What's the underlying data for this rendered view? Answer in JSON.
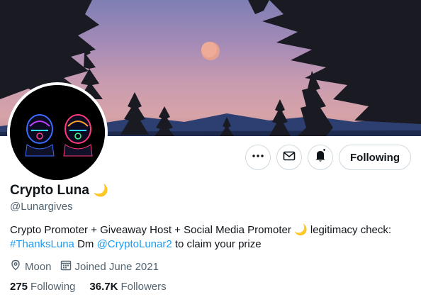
{
  "profile": {
    "name": "Crypto Luna",
    "name_emoji": "🌙",
    "handle": "@Lunargives",
    "bio": {
      "part1": "Crypto Promoter + Giveaway Host + Social Media Promoter",
      "emoji": "🌙",
      "part2": "legitimacy check:",
      "hashtag": "#ThanksLuna",
      "dm_text": "Dm",
      "mention": "@CryptoLunar2",
      "suffix": "to claim your prize"
    },
    "location": "Moon",
    "joined": "Joined June 2021",
    "following_count": "275",
    "following_label": "Following",
    "followers_count": "36.7K",
    "followers_label": "Followers"
  },
  "actions": {
    "more_icon": "more-dots-icon",
    "message_icon": "envelope-icon",
    "notify_icon": "bell-plus-icon",
    "follow_label": "Following"
  },
  "colors": {
    "accent": "#1d9bf0",
    "secondary_text": "#536471",
    "border": "#cfd9de"
  }
}
